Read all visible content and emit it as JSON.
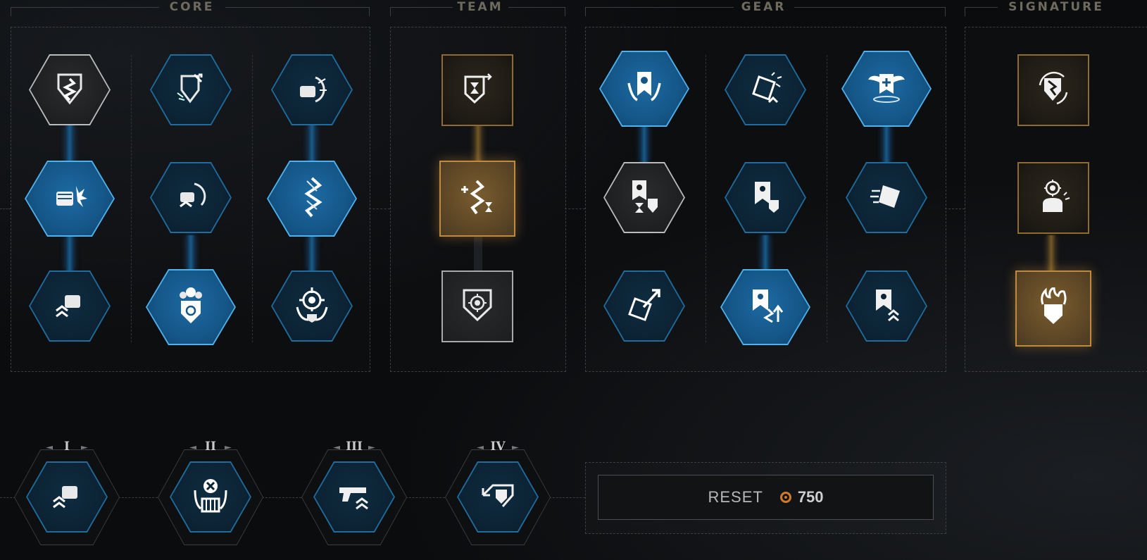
{
  "sections": {
    "core": "CORE",
    "team": "TEAM",
    "gear": "GEAR",
    "signature": "SIGNATURE"
  },
  "core_perks": [
    {
      "icon": "shield-chain-icon",
      "state": "silver"
    },
    {
      "icon": "shield-break-icon",
      "state": "dark"
    },
    {
      "icon": "fist-slam-icon",
      "state": "dark"
    },
    {
      "icon": "fist-impact-icon",
      "state": "selected"
    },
    {
      "icon": "melee-sweep-icon",
      "state": "dark"
    },
    {
      "icon": "chain-link-icon",
      "state": "selected"
    },
    {
      "icon": "fist-rank-up-icon",
      "state": "dark"
    },
    {
      "icon": "skull-target-shield-icon",
      "state": "selected"
    },
    {
      "icon": "skull-crosshair-icon",
      "state": "dark"
    }
  ],
  "team_perks": [
    {
      "icon": "banner-hourglass-icon",
      "state": "gold"
    },
    {
      "icon": "chain-plus-hourglass-icon",
      "state": "gold-selected"
    },
    {
      "icon": "skull-target-badge-icon",
      "state": "silver"
    }
  ],
  "gear_perks": [
    {
      "icon": "skull-banner-claws-icon",
      "state": "selected"
    },
    {
      "icon": "shield-shatter-icon",
      "state": "dark"
    },
    {
      "icon": "winged-medic-banner-icon",
      "state": "selected"
    },
    {
      "icon": "banner-hourglass-shield-icon",
      "state": "silver"
    },
    {
      "icon": "banner-shield-icon",
      "state": "dark"
    },
    {
      "icon": "shield-dash-icon",
      "state": "dark"
    },
    {
      "icon": "shield-arrow-up-icon",
      "state": "dark"
    },
    {
      "icon": "banner-chain-up-icon",
      "state": "selected"
    },
    {
      "icon": "banner-rank-up-icon",
      "state": "dark"
    }
  ],
  "signature_perks": [
    {
      "icon": "shield-swirl-icon",
      "state": "gold"
    },
    {
      "icon": "marine-target-icon",
      "state": "gold"
    },
    {
      "icon": "flaming-shield-icon",
      "state": "gold-selected"
    }
  ],
  "class_traits": [
    {
      "rank": "I",
      "icon": "fist-rank-up-icon"
    },
    {
      "rank": "II",
      "icon": "skull-cross-crate-icon"
    },
    {
      "rank": "III",
      "icon": "pistol-rank-up-icon"
    },
    {
      "rank": "IV",
      "icon": "shield-arrow-back-icon"
    }
  ],
  "reset": {
    "label": "RESET",
    "cost": "750",
    "currency_icon": "requisition-coin-icon"
  },
  "colors": {
    "selected_blue": "#155687",
    "frame_blue": "#3aa0e0",
    "gold": "#c08a3e",
    "silver": "#b9bbbd",
    "coin": "#d07a2a"
  }
}
